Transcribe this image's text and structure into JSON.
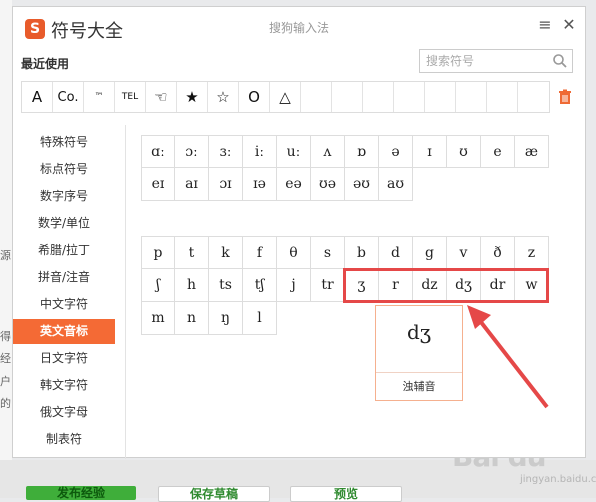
{
  "background": {
    "left_fragments": [
      "源",
      "得",
      "经",
      "户",
      "的"
    ],
    "bottom_buttons": [
      "发布经验",
      "保存草稿",
      "预览"
    ],
    "watermark": "Bai du",
    "watermark_sub": "jingyan.baidu.com"
  },
  "window": {
    "logo": "S",
    "title": "符号大全",
    "subtitle": "搜狗输入法",
    "menu_glyph": "≡",
    "close_glyph": "✕"
  },
  "recent": {
    "label": "最近使用",
    "symbols": [
      "A",
      "Co.",
      "™",
      "TEL",
      "☜",
      "★",
      "☆",
      "O",
      "△",
      "",
      "",
      "",
      "",
      "",
      "",
      "",
      ""
    ]
  },
  "search": {
    "placeholder": "搜索符号"
  },
  "sidebar": {
    "items": [
      "特殊符号",
      "标点符号",
      "数字序号",
      "数学/单位",
      "希腊/拉丁",
      "拼音/注音",
      "中文字符",
      "英文音标",
      "日文字符",
      "韩文字符",
      "俄文字母",
      "制表符"
    ],
    "active_index": 7
  },
  "vowels": {
    "rows": [
      [
        "ɑː",
        "ɔː",
        "ɜː",
        "iː",
        "uː",
        "ʌ",
        "ɒ",
        "ə",
        "ɪ",
        "ʊ",
        "e",
        "æ"
      ],
      [
        "eɪ",
        "aɪ",
        "ɔɪ",
        "ɪə",
        "eə",
        "ʊə",
        "əʊ",
        "aʊ"
      ]
    ]
  },
  "consonants": {
    "rows": [
      [
        "p",
        "t",
        "k",
        "f",
        "θ",
        "s",
        "b",
        "d",
        "g",
        "v",
        "ð",
        "z"
      ],
      [
        "ʃ",
        "h",
        "ts",
        "tʃ",
        "j",
        "tr",
        "ʒ",
        "r",
        "dz",
        "dʒ",
        "dr",
        "w"
      ],
      [
        "m",
        "n",
        "ŋ",
        "l"
      ]
    ]
  },
  "popup": {
    "char": "dʒ",
    "label": "浊辅音"
  },
  "colors": {
    "accent": "#f46a35",
    "highlight": "#e54848",
    "logo": "#e85b2b"
  }
}
